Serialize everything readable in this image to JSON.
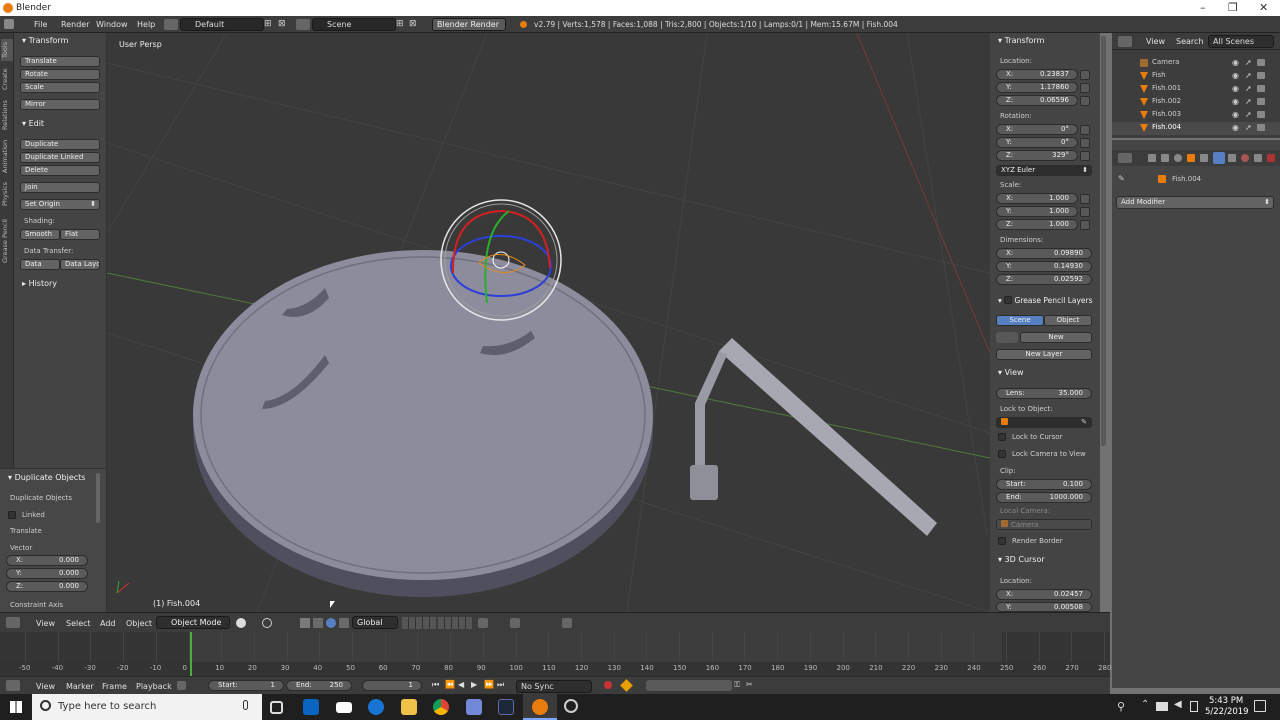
{
  "window": {
    "title": "Blender",
    "min": "–",
    "max": "❐",
    "close": "✕"
  },
  "infobar": {
    "menus": [
      "File",
      "Render",
      "Window",
      "Help"
    ],
    "layout": "Default",
    "scene": "Scene",
    "engine": "Blender Render",
    "stats": "v2.79 | Verts:1,578 | Faces:1,088 | Tris:2,800 | Objects:1/10 | Lamps:0/1 | Mem:15.67M | Fish.004"
  },
  "toolshelf": {
    "tabs": [
      "Tools",
      "Create",
      "Relations",
      "Animation",
      "Physics",
      "Grease Pencil"
    ],
    "transform_title": "Transform",
    "transform_buttons": [
      "Translate",
      "Rotate",
      "Scale",
      "Mirror"
    ],
    "edit_title": "Edit",
    "edit_buttons": [
      "Duplicate",
      "Duplicate Linked",
      "Delete",
      "Join"
    ],
    "set_origin": "Set Origin",
    "shading_label": "Shading:",
    "smooth": "Smooth",
    "flat": "Flat",
    "data_transfer_label": "Data Transfer:",
    "data": "Data",
    "data_layout": "Data Layo",
    "history_title": "History"
  },
  "operator_panel": {
    "title": "Duplicate Objects",
    "sub": "Duplicate Objects",
    "linked": "Linked",
    "translate": "Translate",
    "vector": "Vector",
    "vx": "X:",
    "vxv": "0.000",
    "vy": "Y:",
    "vyv": "0.000",
    "vz": "Z:",
    "vzv": "0.000",
    "constraint": "Constraint Axis"
  },
  "viewport": {
    "view_name": "User Persp",
    "object_label": "(1) Fish.004"
  },
  "npanel": {
    "transform_title": "Transform",
    "location_label": "Location:",
    "loc": [
      {
        "k": "X:",
        "v": "0.23837"
      },
      {
        "k": "Y:",
        "v": "1.17860"
      },
      {
        "k": "Z:",
        "v": "0.06596"
      }
    ],
    "rotation_label": "Rotation:",
    "rot": [
      {
        "k": "X:",
        "v": "0°"
      },
      {
        "k": "Y:",
        "v": "0°"
      },
      {
        "k": "Z:",
        "v": "329°"
      }
    ],
    "euler": "XYZ Euler",
    "scale_label": "Scale:",
    "scale": [
      {
        "k": "X:",
        "v": "1.000"
      },
      {
        "k": "Y:",
        "v": "1.000"
      },
      {
        "k": "Z:",
        "v": "1.000"
      }
    ],
    "dimensions_label": "Dimensions:",
    "dims": [
      {
        "k": "X:",
        "v": "0.09890"
      },
      {
        "k": "Y:",
        "v": "0.14930"
      },
      {
        "k": "Z:",
        "v": "0.02592"
      }
    ],
    "gp_title": "Grease Pencil Layers",
    "gp_scene": "Scene",
    "gp_object": "Object",
    "gp_new": "New",
    "gp_new_layer": "New Layer",
    "view_title": "View",
    "lens_k": "Lens:",
    "lens_v": "35.000",
    "lock_to_object": "Lock to Object:",
    "lock_to_cursor": "Lock to Cursor",
    "lock_camera": "Lock Camera to View",
    "clip_label": "Clip:",
    "clip_start_k": "Start:",
    "clip_start_v": "0.100",
    "clip_end_k": "End:",
    "clip_end_v": "1000.000",
    "local_camera": "Local Camera:",
    "camera": "Camera",
    "render_border": "Render Border",
    "cursor_title": "3D Cursor",
    "cursor_location": "Location:",
    "cursor_x_k": "X:",
    "cursor_x_v": "0.02457",
    "cursor_y_k": "Y:",
    "cursor_y_v": "0.00508"
  },
  "outliner": {
    "view": "View",
    "search": "Search",
    "filter": "All Scenes",
    "items": [
      "Camera",
      "Fish",
      "Fish.001",
      "Fish.002",
      "Fish.003",
      "Fish.004"
    ]
  },
  "properties": {
    "object_name": "Fish.004",
    "add_modifier": "Add Modifier"
  },
  "viewport_header": {
    "view": "View",
    "select": "Select",
    "add": "Add",
    "object": "Object",
    "mode": "Object Mode",
    "orientation": "Global"
  },
  "timeline": {
    "ticks": [
      "-50",
      "-40",
      "-30",
      "-20",
      "-10",
      "0",
      "10",
      "20",
      "30",
      "40",
      "50",
      "60",
      "70",
      "80",
      "90",
      "100",
      "110",
      "120",
      "130",
      "140",
      "150",
      "160",
      "170",
      "180",
      "190",
      "200",
      "210",
      "220",
      "230",
      "240",
      "250",
      "260",
      "270",
      "280"
    ],
    "view": "View",
    "marker": "Marker",
    "frame": "Frame",
    "playback": "Playback",
    "start_k": "Start:",
    "start_v": "1",
    "end_k": "End:",
    "end_v": "250",
    "current": "1",
    "sync": "No Sync"
  },
  "taskbar": {
    "search_placeholder": "Type here to search",
    "time": "5:43 PM",
    "date": "5/22/2019"
  }
}
